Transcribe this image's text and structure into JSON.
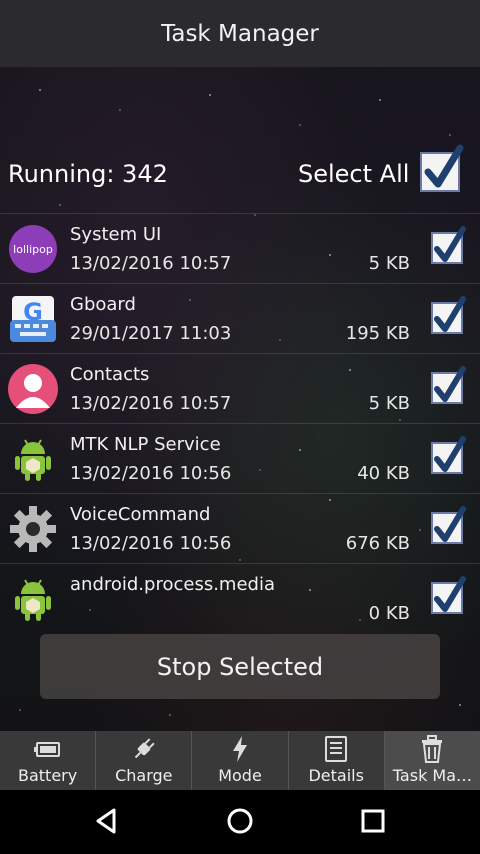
{
  "title": "Task Manager",
  "header": {
    "running": "Running: 342",
    "select_all": "Select All"
  },
  "tasks": [
    {
      "name": "System UI",
      "date": "13/02/2016 10:57",
      "size": "5 KB",
      "icon": "lollipop-icon",
      "icon_text": "lollipop"
    },
    {
      "name": "Gboard",
      "date": "29/01/2017 11:03",
      "size": "195 KB",
      "icon": "gboard-icon"
    },
    {
      "name": "Contacts",
      "date": "13/02/2016 10:57",
      "size": "5 KB",
      "icon": "contacts-icon"
    },
    {
      "name": "MTK NLP Service",
      "date": "13/02/2016 10:56",
      "size": "40 KB",
      "icon": "android-icon"
    },
    {
      "name": "VoiceCommand",
      "date": "13/02/2016 10:56",
      "size": "676 KB",
      "icon": "gear-icon"
    },
    {
      "name": "android.process.media",
      "date": "",
      "size": "0 KB",
      "icon": "android-icon"
    }
  ],
  "stop_button": "Stop Selected",
  "tabs": [
    {
      "label": "Battery",
      "icon": "battery-icon"
    },
    {
      "label": "Charge",
      "icon": "plug-icon"
    },
    {
      "label": "Mode",
      "icon": "lightning-icon"
    },
    {
      "label": "Details",
      "icon": "document-icon"
    },
    {
      "label": "Task Ma…",
      "icon": "trash-icon"
    }
  ],
  "colors": {
    "titlebar": "#2b2a2e",
    "tabbar": "#3a3939",
    "android_green": "#8ac43c",
    "contacts_pink": "#e54f7a"
  }
}
